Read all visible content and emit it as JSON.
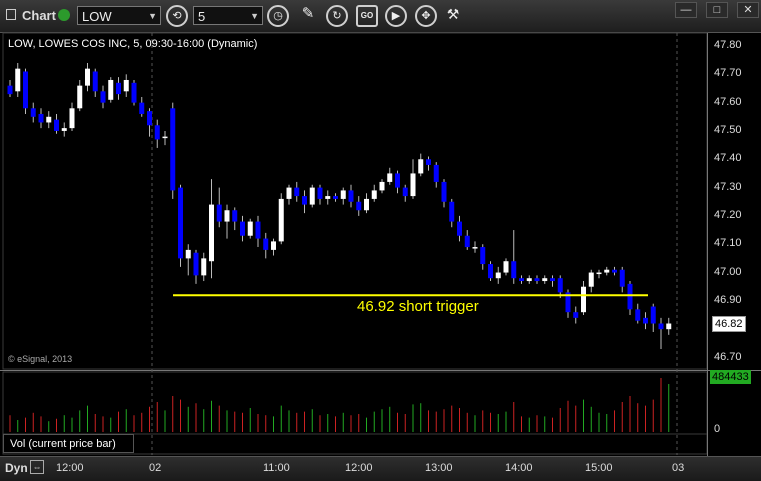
{
  "toolbar": {
    "chart_label": "Chart",
    "symbol": "LOW",
    "interval": "5",
    "window_buttons": [
      "—",
      "□",
      "✕"
    ],
    "tools": [
      "cycle-icon",
      "clock-icon",
      "pencil-icon",
      "refresh-icon",
      "text-icon",
      "play-icon",
      "crosshair-icon"
    ]
  },
  "price_panel": {
    "title": "LOW, LOWES COS INC, 5, 09:30-16:00 (Dynamic)",
    "copyright": "© eSignal, 2013",
    "y_ticks": [
      "47.80",
      "47.70",
      "47.60",
      "47.50",
      "47.40",
      "47.30",
      "47.20",
      "47.10",
      "47.00",
      "46.90",
      "46.80",
      "46.70"
    ],
    "last_price": "46.82",
    "annotation": "46.92 short trigger",
    "annotation_color": "#ffff00",
    "up_color": "#ffffff",
    "down_color": "#0000ff"
  },
  "volume_panel": {
    "title": "Vol (current price bar)",
    "zero_label": "0",
    "last_volume": "484433",
    "badge_color": "#22aa22"
  },
  "x_axis": {
    "labels": [
      "12:00",
      "02",
      "11:00",
      "12:00",
      "13:00",
      "14:00",
      "15:00",
      "03"
    ]
  },
  "bottom": {
    "dyn_label": "Dyn"
  },
  "chart_data": {
    "type": "candlestick",
    "title": "LOW, LOWES COS INC, 5, 09:30-16:00 (Dynamic)",
    "ylim": [
      46.66,
      47.84
    ],
    "trigger_level": 46.92,
    "trigger_label": "46.92 short trigger",
    "candles": [
      [
        47.66,
        47.63,
        47.68,
        47.62
      ],
      [
        47.64,
        47.72,
        47.74,
        47.62
      ],
      [
        47.71,
        47.58,
        47.72,
        47.56
      ],
      [
        47.58,
        47.55,
        47.6,
        47.53
      ],
      [
        47.56,
        47.53,
        47.58,
        47.51
      ],
      [
        47.53,
        47.55,
        47.57,
        47.51
      ],
      [
        47.54,
        47.5,
        47.56,
        47.49
      ],
      [
        47.5,
        47.51,
        47.53,
        47.48
      ],
      [
        47.51,
        47.58,
        47.6,
        47.5
      ],
      [
        47.58,
        47.66,
        47.68,
        47.57
      ],
      [
        47.66,
        47.72,
        47.74,
        47.64
      ],
      [
        47.71,
        47.64,
        47.72,
        47.62
      ],
      [
        47.64,
        47.6,
        47.66,
        47.58
      ],
      [
        47.61,
        47.68,
        47.69,
        47.6
      ],
      [
        47.67,
        47.63,
        47.69,
        47.61
      ],
      [
        47.64,
        47.68,
        47.7,
        47.62
      ],
      [
        47.67,
        47.6,
        47.68,
        47.59
      ],
      [
        47.6,
        47.56,
        47.62,
        47.55
      ],
      [
        47.57,
        47.52,
        47.58,
        47.48
      ],
      [
        47.52,
        47.47,
        47.54,
        47.44
      ],
      [
        47.48,
        47.48,
        47.5,
        47.45
      ],
      [
        47.58,
        47.29,
        47.6,
        47.26
      ],
      [
        47.3,
        47.05,
        47.31,
        47.02
      ],
      [
        47.05,
        47.08,
        47.1,
        46.99
      ],
      [
        47.07,
        46.99,
        47.08,
        46.96
      ],
      [
        46.99,
        47.05,
        47.07,
        46.97
      ],
      [
        47.04,
        47.24,
        47.33,
        46.98
      ],
      [
        47.24,
        47.18,
        47.3,
        47.16
      ],
      [
        47.18,
        47.22,
        47.24,
        47.12
      ],
      [
        47.22,
        47.18,
        47.23,
        47.15
      ],
      [
        47.18,
        47.13,
        47.2,
        47.11
      ],
      [
        47.13,
        47.18,
        47.19,
        47.12
      ],
      [
        47.18,
        47.12,
        47.2,
        47.09
      ],
      [
        47.12,
        47.08,
        47.14,
        47.05
      ],
      [
        47.08,
        47.11,
        47.12,
        47.06
      ],
      [
        47.11,
        47.26,
        47.28,
        47.1
      ],
      [
        47.26,
        47.3,
        47.31,
        47.24
      ],
      [
        47.3,
        47.27,
        47.32,
        47.25
      ],
      [
        47.27,
        47.24,
        47.29,
        47.21
      ],
      [
        47.24,
        47.3,
        47.31,
        47.23
      ],
      [
        47.3,
        47.26,
        47.31,
        47.24
      ],
      [
        47.26,
        47.27,
        47.29,
        47.24
      ],
      [
        47.27,
        47.26,
        47.28,
        47.25
      ],
      [
        47.26,
        47.29,
        47.3,
        47.24
      ],
      [
        47.29,
        47.25,
        47.31,
        47.23
      ],
      [
        47.25,
        47.22,
        47.27,
        47.2
      ],
      [
        47.22,
        47.26,
        47.28,
        47.21
      ],
      [
        47.26,
        47.29,
        47.31,
        47.25
      ],
      [
        47.29,
        47.32,
        47.33,
        47.28
      ],
      [
        47.32,
        47.35,
        47.37,
        47.31
      ],
      [
        47.35,
        47.3,
        47.36,
        47.28
      ],
      [
        47.3,
        47.27,
        47.31,
        47.25
      ],
      [
        47.27,
        47.35,
        47.4,
        47.26
      ],
      [
        47.35,
        47.4,
        47.42,
        47.34
      ],
      [
        47.4,
        47.38,
        47.41,
        47.36
      ],
      [
        47.38,
        47.32,
        47.39,
        47.3
      ],
      [
        47.32,
        47.25,
        47.33,
        47.23
      ],
      [
        47.25,
        47.18,
        47.26,
        47.16
      ],
      [
        47.18,
        47.13,
        47.2,
        47.11
      ],
      [
        47.13,
        47.09,
        47.15,
        47.08
      ],
      [
        47.09,
        47.09,
        47.11,
        47.07
      ],
      [
        47.09,
        47.03,
        47.1,
        47.01
      ],
      [
        47.03,
        46.98,
        47.04,
        46.97
      ],
      [
        46.98,
        47.0,
        47.02,
        46.96
      ],
      [
        47.0,
        47.04,
        47.05,
        46.99
      ],
      [
        47.04,
        46.98,
        47.15,
        46.96
      ],
      [
        46.98,
        46.97,
        46.99,
        46.96
      ],
      [
        46.97,
        46.98,
        46.99,
        46.96
      ],
      [
        46.98,
        46.97,
        46.99,
        46.96
      ],
      [
        46.97,
        46.98,
        46.99,
        46.96
      ],
      [
        46.98,
        46.97,
        46.99,
        46.95
      ],
      [
        46.98,
        46.93,
        46.99,
        46.91
      ],
      [
        46.93,
        46.86,
        46.94,
        46.84
      ],
      [
        46.86,
        46.84,
        46.88,
        46.82
      ],
      [
        46.86,
        46.95,
        46.97,
        46.85
      ],
      [
        46.95,
        47.0,
        47.01,
        46.93
      ],
      [
        47.0,
        47.0,
        47.01,
        46.98
      ],
      [
        47.0,
        47.01,
        47.02,
        46.99
      ],
      [
        47.01,
        47.0,
        47.02,
        46.99
      ],
      [
        47.01,
        46.95,
        47.02,
        46.93
      ],
      [
        46.96,
        46.87,
        46.97,
        46.85
      ],
      [
        46.87,
        46.83,
        46.89,
        46.82
      ],
      [
        46.84,
        46.82,
        46.86,
        46.8
      ],
      [
        46.88,
        46.82,
        46.89,
        46.79
      ],
      [
        46.82,
        46.8,
        46.84,
        46.73
      ],
      [
        46.8,
        46.82,
        46.84,
        46.78
      ]
    ],
    "volume": [
      14,
      10,
      12,
      16,
      13,
      9,
      11,
      14,
      12,
      18,
      22,
      15,
      13,
      12,
      17,
      19,
      14,
      16,
      21,
      25,
      18,
      30,
      27,
      21,
      24,
      19,
      26,
      22,
      18,
      17,
      16,
      20,
      15,
      14,
      13,
      22,
      18,
      16,
      17,
      19,
      14,
      15,
      13,
      16,
      14,
      15,
      12,
      17,
      19,
      21,
      16,
      15,
      23,
      24,
      18,
      17,
      19,
      22,
      20,
      16,
      14,
      18,
      16,
      15,
      17,
      25,
      13,
      12,
      14,
      13,
      12,
      20,
      26,
      22,
      27,
      21,
      16,
      15,
      18,
      25,
      30,
      24,
      22,
      27,
      45,
      40
    ]
  }
}
